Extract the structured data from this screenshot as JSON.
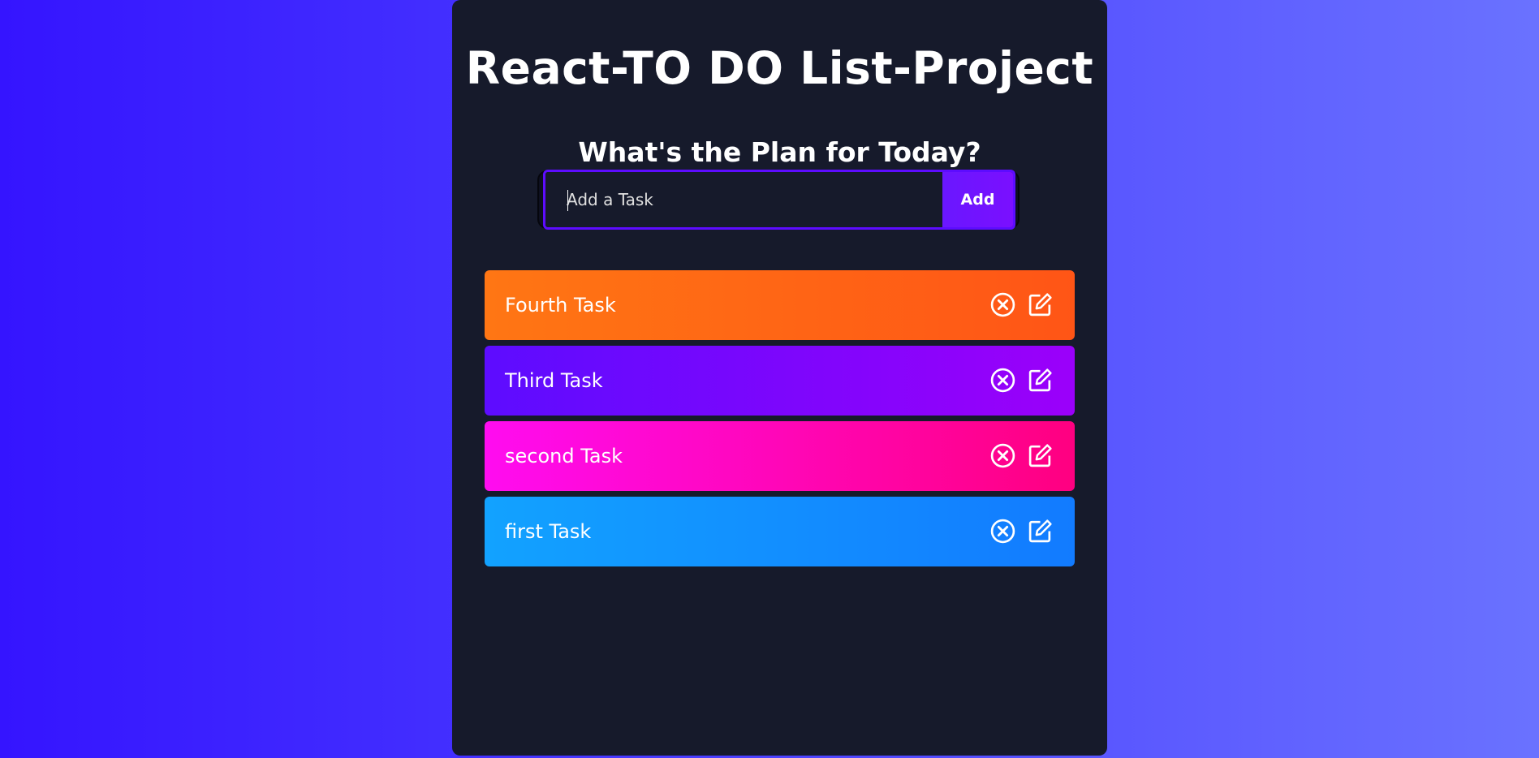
{
  "app": {
    "title": "React-TO DO List-Project",
    "subtitle": "What's the Plan for Today?"
  },
  "form": {
    "placeholder": "Add a Task",
    "value": "",
    "add_label": "Add"
  },
  "tasks": [
    {
      "text": "Fourth Task",
      "color_from": "#ff7614",
      "color_to": "#ff5516"
    },
    {
      "text": "Third Task",
      "color_from": "#5d0cff",
      "color_to": "#9b00fa"
    },
    {
      "text": "second Task",
      "color_from": "#ff0cf0",
      "color_to": "#ff0080"
    },
    {
      "text": "first Task",
      "color_from": "#12a2ff",
      "color_to": "#127bff"
    }
  ],
  "icons": {
    "delete": "close-circle-icon",
    "edit": "edit-icon"
  },
  "colors": {
    "accent": "#5d0cff",
    "panel": "#161a2b",
    "background_from": "#3514ff",
    "background_to": "#6a72ff"
  }
}
